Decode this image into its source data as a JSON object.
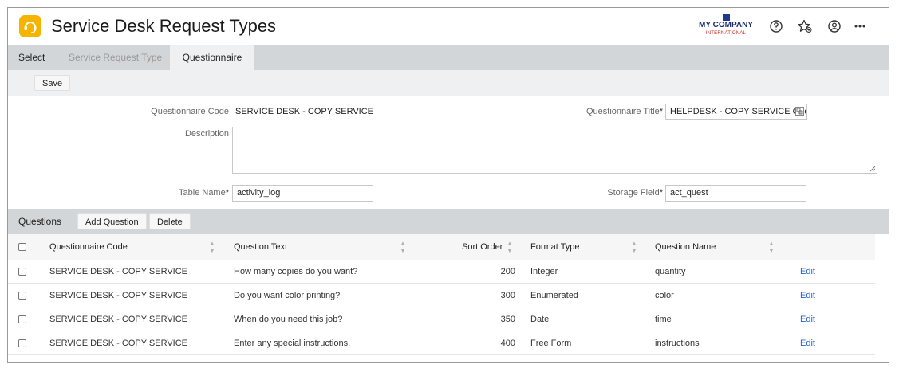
{
  "header": {
    "title": "Service Desk Request Types",
    "company": {
      "name": "MY COMPANY",
      "sub": "INTERNATIONAL"
    },
    "icons": [
      "help-icon",
      "favorites-icon",
      "user-icon",
      "more-icon"
    ]
  },
  "tabs": {
    "select": "Select",
    "service_request_type": "Service Request Type",
    "questionnaire": "Questionnaire"
  },
  "toolbar": {
    "save_label": "Save"
  },
  "form": {
    "code_label": "Questionnaire Code",
    "code_value": "SERVICE DESK - COPY SERVICE",
    "title_label": "Questionnaire Title",
    "title_value": "HELPDESK - COPY SERVICE Questi",
    "description_label": "Description",
    "description_value": "",
    "table_label": "Table Name",
    "table_value": "activity_log",
    "storage_label": "Storage Field",
    "storage_value": "act_quest",
    "required_mark": "*"
  },
  "questions": {
    "title": "Questions",
    "add_label": "Add Question",
    "delete_label": "Delete",
    "columns": {
      "code": "Questionnaire Code",
      "text": "Question Text",
      "sort": "Sort Order",
      "format": "Format Type",
      "name": "Question Name"
    },
    "edit_label": "Edit",
    "rows": [
      {
        "code": "SERVICE DESK - COPY SERVICE",
        "text": "How many copies do you want?",
        "sort": "200",
        "format": "Integer",
        "name": "quantity"
      },
      {
        "code": "SERVICE DESK - COPY SERVICE",
        "text": "Do you want color printing?",
        "sort": "300",
        "format": "Enumerated",
        "name": "color"
      },
      {
        "code": "SERVICE DESK - COPY SERVICE",
        "text": "When do you need this job?",
        "sort": "350",
        "format": "Date",
        "name": "time"
      },
      {
        "code": "SERVICE DESK - COPY SERVICE",
        "text": "Enter any special instructions.",
        "sort": "400",
        "format": "Free Form",
        "name": "instructions"
      }
    ]
  },
  "colors": {
    "accent": "#f5b400",
    "tabbar": "#d3d6d9",
    "panel": "#eef0f1",
    "link": "#2a66c7"
  }
}
